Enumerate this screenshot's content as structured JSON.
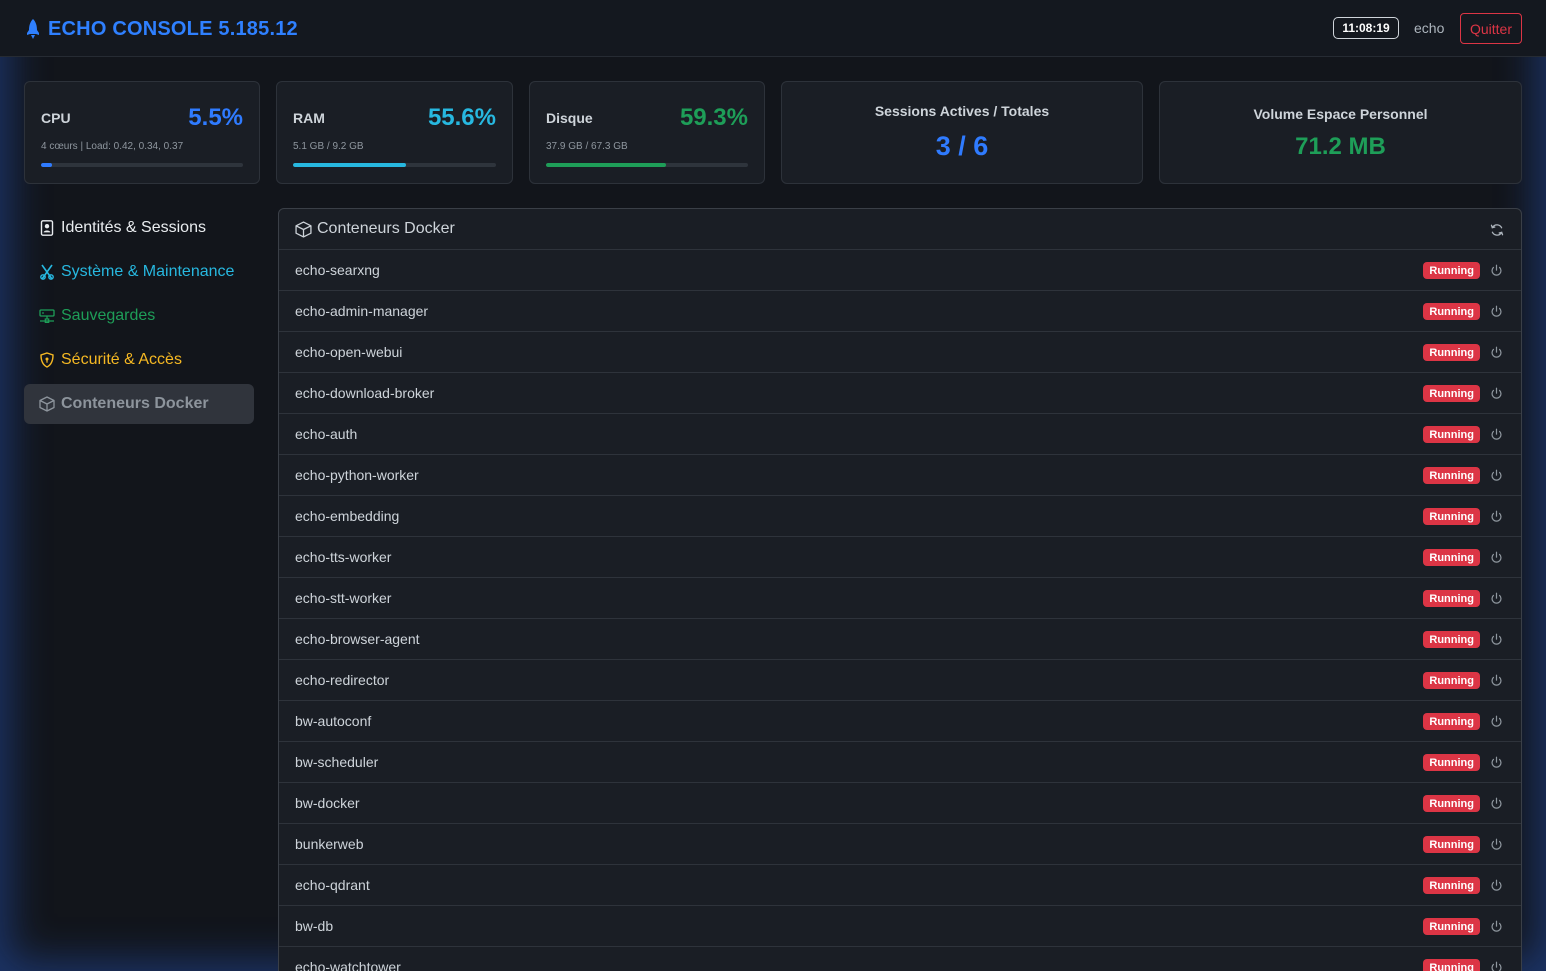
{
  "header": {
    "title": "ECHO CONSOLE 5.185.12",
    "clock": "11:08:19",
    "user": "echo",
    "quit_label": "Quitter",
    "accent": "#2f80ff"
  },
  "stats": {
    "cpu": {
      "label": "CPU",
      "value": "5.5%",
      "sub": "4 cœurs | Load: 0.42, 0.34, 0.37",
      "fraction": 0.055,
      "color": "#2f7bff"
    },
    "ram": {
      "label": "RAM",
      "value": "55.6%",
      "sub": "5.1 GB / 9.2 GB",
      "fraction": 0.556,
      "color": "#27b8e0"
    },
    "disk": {
      "label": "Disque",
      "value": "59.3%",
      "sub": "37.9 GB / 67.3 GB",
      "fraction": 0.593,
      "color": "#1e9e58"
    },
    "sessions": {
      "label": "Sessions Actives / Totales",
      "value": "3 / 6",
      "color": "#2f7bff"
    },
    "volume": {
      "label": "Volume Espace Personnel",
      "value": "71.2 MB",
      "color": "#1e9e58"
    }
  },
  "sidebar": {
    "items": [
      {
        "label": "Identités & Sessions",
        "icon": "id-badge-icon",
        "color": "#e9ecef"
      },
      {
        "label": "Système & Maintenance",
        "icon": "tools-icon",
        "color": "#27b8e0"
      },
      {
        "label": "Sauvegardes",
        "icon": "hdd-network-icon",
        "color": "#1e9e58"
      },
      {
        "label": "Sécurité & Accès",
        "icon": "shield-lock-icon",
        "color": "#f5b823"
      },
      {
        "label": "Conteneurs Docker",
        "icon": "box-icon",
        "color": "#8d949c",
        "active": true
      }
    ]
  },
  "panel": {
    "title": "Conteneurs Docker",
    "status_label": "Running",
    "containers": [
      "echo-searxng",
      "echo-admin-manager",
      "echo-open-webui",
      "echo-download-broker",
      "echo-auth",
      "echo-python-worker",
      "echo-embedding",
      "echo-tts-worker",
      "echo-stt-worker",
      "echo-browser-agent",
      "echo-redirector",
      "bw-autoconf",
      "bw-scheduler",
      "bw-docker",
      "bunkerweb",
      "echo-qdrant",
      "bw-db",
      "echo-watchtower"
    ]
  }
}
